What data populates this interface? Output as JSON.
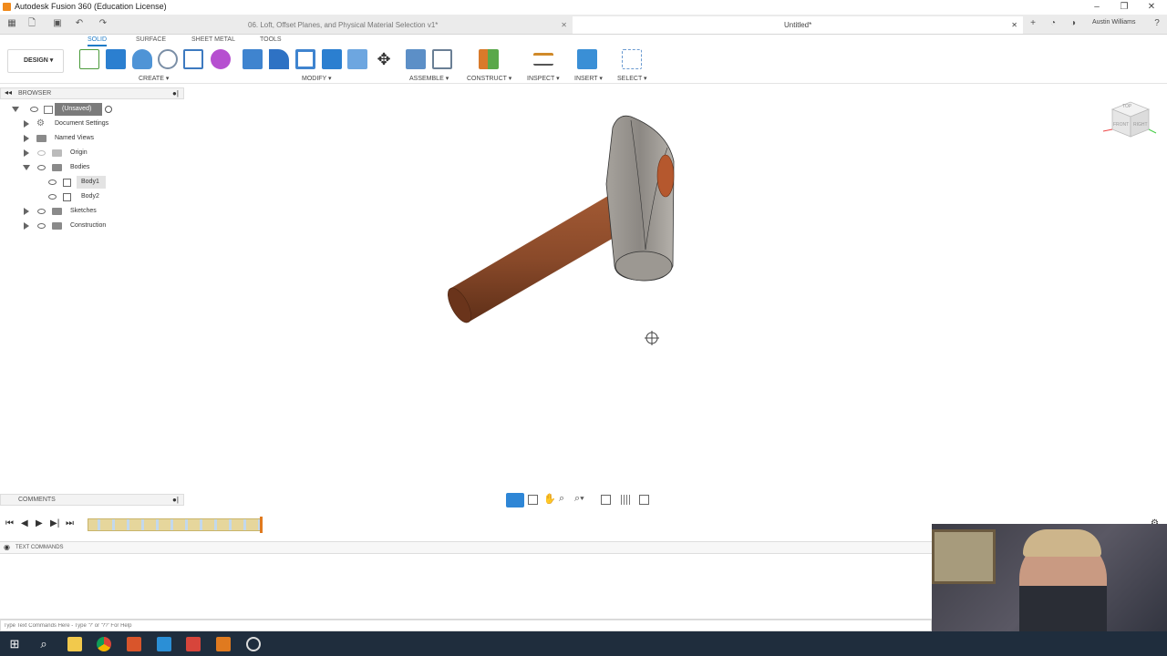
{
  "app": {
    "title": "Autodesk Fusion 360 (Education License)",
    "user": "Austin Williams"
  },
  "tabs": [
    {
      "label": "06. Loft, Offset Planes, and Physical Material Selection v1*",
      "active": false
    },
    {
      "label": "Untitled*",
      "active": true
    }
  ],
  "workspace": {
    "selector_label": "DESIGN",
    "tabs": [
      "SOLID",
      "SURFACE",
      "SHEET METAL",
      "TOOLS"
    ],
    "active_tab": "SOLID"
  },
  "toolbar_groups": {
    "create": "CREATE",
    "modify": "MODIFY",
    "assemble": "ASSEMBLE",
    "construct": "CONSTRUCT",
    "inspect": "INSPECT",
    "insert": "INSERT",
    "select": "SELECT"
  },
  "browser": {
    "title": "BROWSER",
    "root": "(Unsaved)",
    "items": [
      "Document Settings",
      "Named Views",
      "Origin",
      "Bodies",
      "Body1",
      "Body2",
      "Sketches",
      "Construction"
    ]
  },
  "comments": {
    "title": "COMMENTS"
  },
  "viewcube": {
    "top": "TOP",
    "front": "FRONT",
    "right": "RIGHT"
  },
  "text_commands": {
    "title": "TEXT COMMANDS",
    "placeholder": "Type Text Commands Here - Type '?' or '??' For Help"
  },
  "colors": {
    "accent": "#1e7bc7",
    "handle": "#8a4a2a",
    "head": "#8c8883",
    "taskbar": "#1f2d3d"
  },
  "icons": [
    "data-panel-icon",
    "file-icon",
    "save-icon",
    "undo-icon",
    "redo-icon",
    "home-icon",
    "search-icon"
  ]
}
